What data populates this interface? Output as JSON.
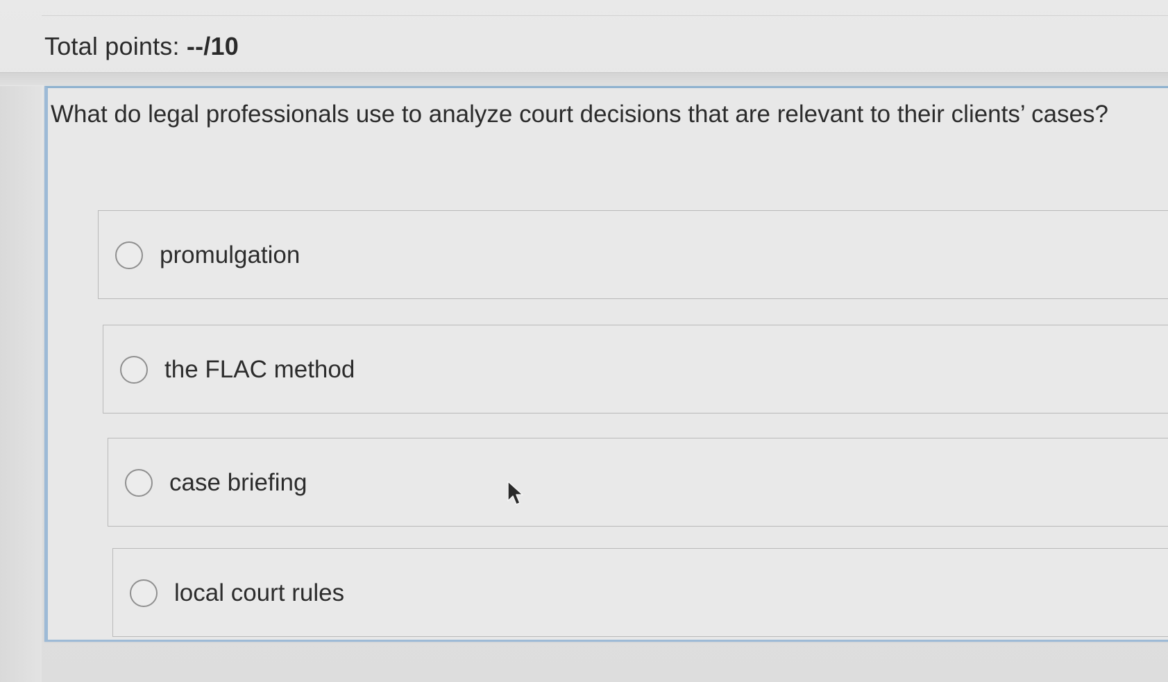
{
  "header": {
    "points_label": "Total points: ",
    "points_value": "--/10"
  },
  "question": {
    "text": "What do legal professionals use to analyze court decisions that are relevant to their clients’ cases?",
    "options": [
      {
        "label": "promulgation",
        "selected": false
      },
      {
        "label": "the FLAC method",
        "selected": false
      },
      {
        "label": "case briefing",
        "selected": false
      },
      {
        "label": "local court rules",
        "selected": false
      }
    ]
  },
  "colors": {
    "card_accent": "#9dbad6",
    "background": "#e4e4e4",
    "text": "#2b2b2b"
  },
  "icons": {
    "cursor": "mouse-pointer-icon",
    "radio": "radio-circle-icon"
  }
}
